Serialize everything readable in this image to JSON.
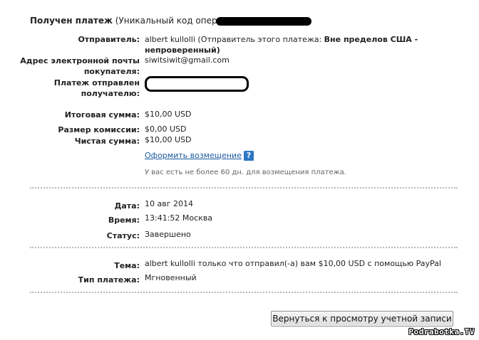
{
  "header": {
    "received_label": "Получен платеж",
    "code_prefix": "(Уникальный код операции"
  },
  "sender": {
    "label": "Отправитель:",
    "name": "albert kullolli",
    "note_prefix": "(Отправитель этого платежа:",
    "note_bold": "Вне пределов США -",
    "note_bold_2": "непроверенный)"
  },
  "buyer_email": {
    "label_1": "Адрес электронной почты",
    "label_2": "покупателя:",
    "value": "siwitsiwit@gmail.com"
  },
  "sent_to": {
    "label_1": "Платеж отправлен",
    "label_2": "получателю:"
  },
  "amounts": {
    "total_label": "Итоговая сумма:",
    "total_value": "$10,00 USD",
    "fee_label": "Размер комиссии:",
    "fee_value": "$0,00 USD",
    "net_label": "Чистая сумма:",
    "net_value": "$10,00 USD"
  },
  "refund": {
    "link": "Оформить возмещение",
    "help_icon": "?",
    "note": "У вас есть не более 60 дн. для возмещения платежа."
  },
  "details": {
    "date_label": "Дата:",
    "date_value": "10 авг 2014",
    "time_label": "Время:",
    "time_value": "13:41:52 Москва",
    "status_label": "Статус:",
    "status_value": "Завершено"
  },
  "subject": {
    "label": "Тема:",
    "value": "albert kullolli только что отправил(-а) вам $10,00 USD с помощью PayPal",
    "type_label": "Тип платежа:",
    "type_value": "Мгновенный"
  },
  "footer": {
    "back_button": "Вернуться к просмотру учетной записи",
    "watermark": "Podrabotka.TV"
  }
}
